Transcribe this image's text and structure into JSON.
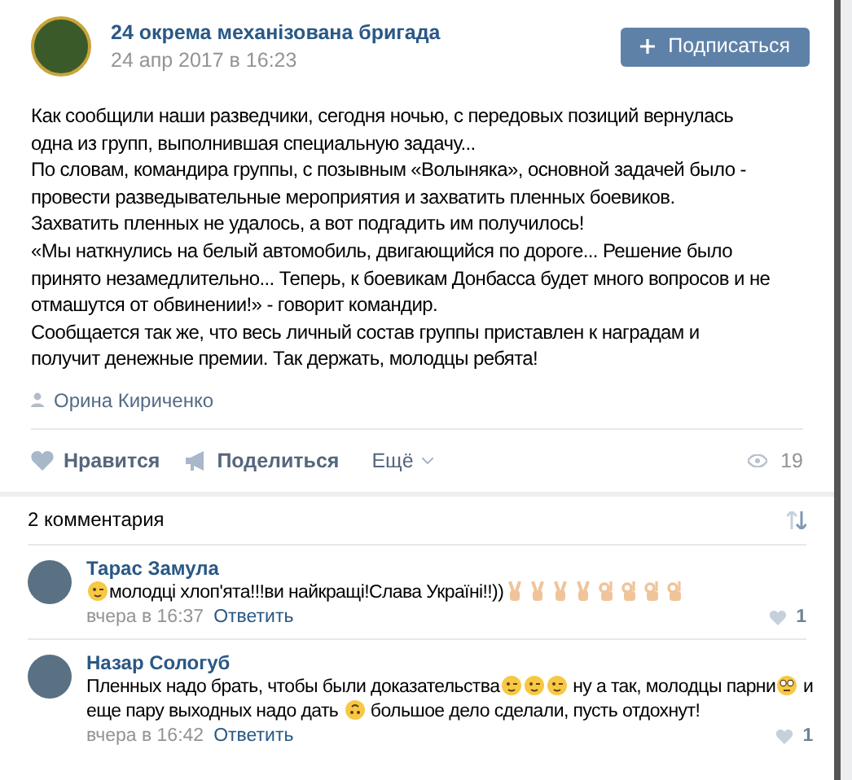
{
  "post": {
    "author": "24 окрема механізована бригада",
    "date": "24 апр 2017 в 16:23",
    "subscribe_button": "Подписаться",
    "lines": [
      "Как сообщили наши разведчики, сегодня ночью, с передовых позиций вернулась",
      "одна из групп, выполнившая специальную задачу...",
      "По словам, командира группы, с позывным «Волыняка», основной задачей было -",
      "провести разведывательные мероприятия и захватить пленных боевиков.",
      "Захватить пленных не удалось, а вот подгадить им получилось!",
      "«Мы наткнулись на белый автомобиль, двигающийся по дороге... Решение было",
      "принято незамедлительно... Теперь, к боевикам Донбасса будет много вопросов и не",
      "отмашутся от обвинении!» - говорит командир.",
      "Сообщается так же, что весь личный состав группы приставлен к наградам и",
      "получит денежные премии. Так держать, молодцы ребята!"
    ],
    "signer": "Орина Кириченко",
    "actions": {
      "like": "Нравится",
      "share": "Поделиться",
      "more": "Ещё",
      "views": "19"
    }
  },
  "comments": {
    "count_label": "2 комментария",
    "items": [
      {
        "author": "Тарас Замула",
        "time": "вчера в 16:37",
        "reply": "Ответить",
        "likes": "1",
        "lines": [
          [
            {
              "kind": "wink"
            },
            {
              "kind": "text",
              "text": "молодці хлоп'ята!!!ви найкращі!Слава Україні!!))"
            },
            {
              "kind": "victory"
            },
            {
              "kind": "victory"
            },
            {
              "kind": "victory"
            },
            {
              "kind": "victory"
            },
            {
              "kind": "ok"
            },
            {
              "kind": "ok"
            },
            {
              "kind": "ok"
            },
            {
              "kind": "ok"
            }
          ]
        ]
      },
      {
        "author": "Назар Сологуб",
        "time": "вчера в 16:42",
        "reply": "Ответить",
        "likes": "1",
        "lines": [
          [
            {
              "kind": "text",
              "text": "Пленных надо брать, чтобы были доказательства"
            },
            {
              "kind": "wink"
            },
            {
              "kind": "wink"
            },
            {
              "kind": "wink"
            },
            {
              "kind": "text",
              "text": " ну а так, молодцы парни"
            },
            {
              "kind": "surprised"
            },
            {
              "kind": "text",
              "text": " и"
            }
          ],
          [
            {
              "kind": "text",
              "text": "еще пару выходных надо дать "
            },
            {
              "kind": "upside"
            },
            {
              "kind": "text",
              "text": " большое дело сделали, пусть отдохнут!"
            }
          ]
        ]
      }
    ]
  }
}
